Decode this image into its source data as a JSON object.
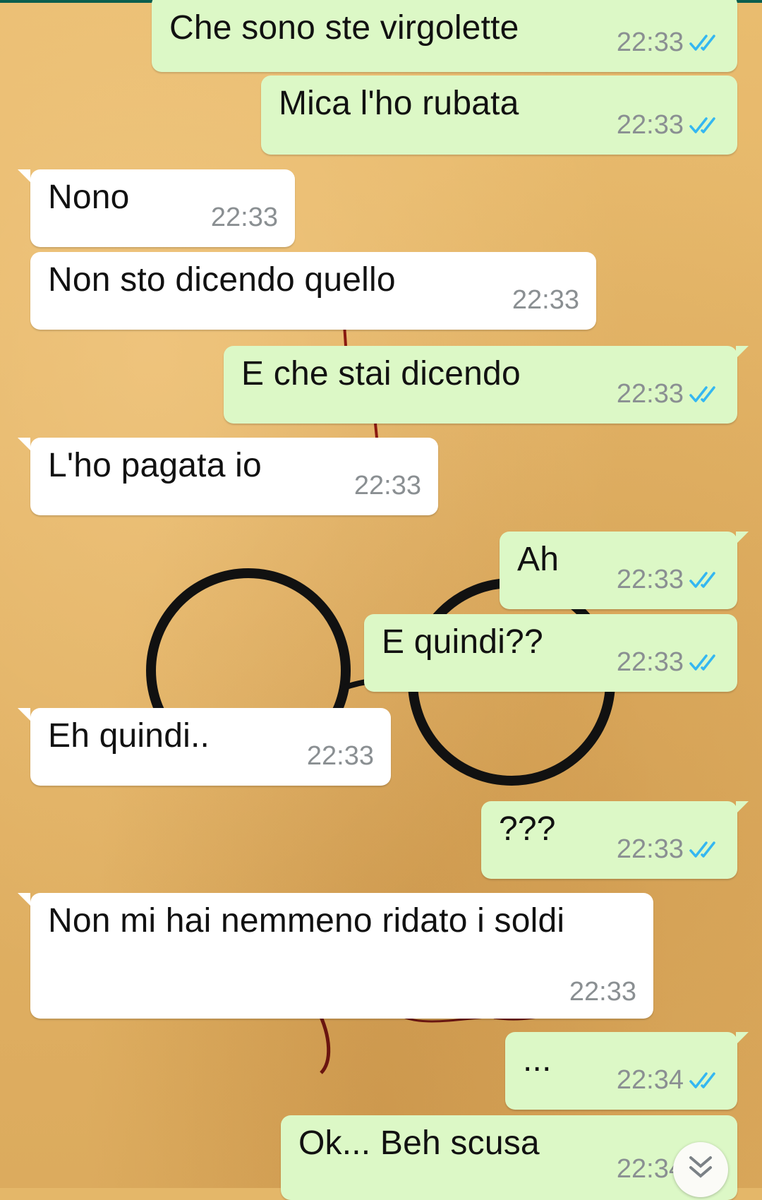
{
  "chat": {
    "messages": [
      {
        "direction": "out",
        "text": "Che sono ste virgolette",
        "time": "22:33",
        "status": "read-double-check-icon"
      },
      {
        "direction": "out",
        "text": "Mica l'ho rubata",
        "time": "22:33",
        "status": "read-double-check-icon"
      },
      {
        "direction": "in",
        "text": "Nono",
        "time": "22:33"
      },
      {
        "direction": "in",
        "text": "Non sto dicendo quello",
        "time": "22:33"
      },
      {
        "direction": "out",
        "text": "E che stai dicendo",
        "time": "22:33",
        "status": "read-double-check-icon"
      },
      {
        "direction": "in",
        "text": "L'ho pagata io",
        "time": "22:33"
      },
      {
        "direction": "out",
        "text": "Ah",
        "time": "22:33",
        "status": "read-double-check-icon"
      },
      {
        "direction": "out",
        "text": "E quindi??",
        "time": "22:33",
        "status": "read-double-check-icon"
      },
      {
        "direction": "in",
        "text": "Eh quindi..",
        "time": "22:33"
      },
      {
        "direction": "out",
        "text": "???",
        "time": "22:33",
        "status": "read-double-check-icon"
      },
      {
        "direction": "in",
        "text": "Non mi hai nemmeno ridato i soldi",
        "time": "22:33"
      },
      {
        "direction": "out",
        "text": "...",
        "time": "22:34",
        "status": "read-double-check-icon"
      },
      {
        "direction": "out",
        "text": "Ok... Beh scusa",
        "time": "22:34",
        "status": "read-double-check-icon"
      }
    ],
    "scroll_button_icon": "double-chevron-down-icon"
  },
  "colors": {
    "outgoing_bubble": "#dcf8c6",
    "incoming_bubble": "#ffffff",
    "read_tick": "#34b7f1",
    "timestamp": "#8a8f92",
    "wallpaper": "#e4b769"
  }
}
